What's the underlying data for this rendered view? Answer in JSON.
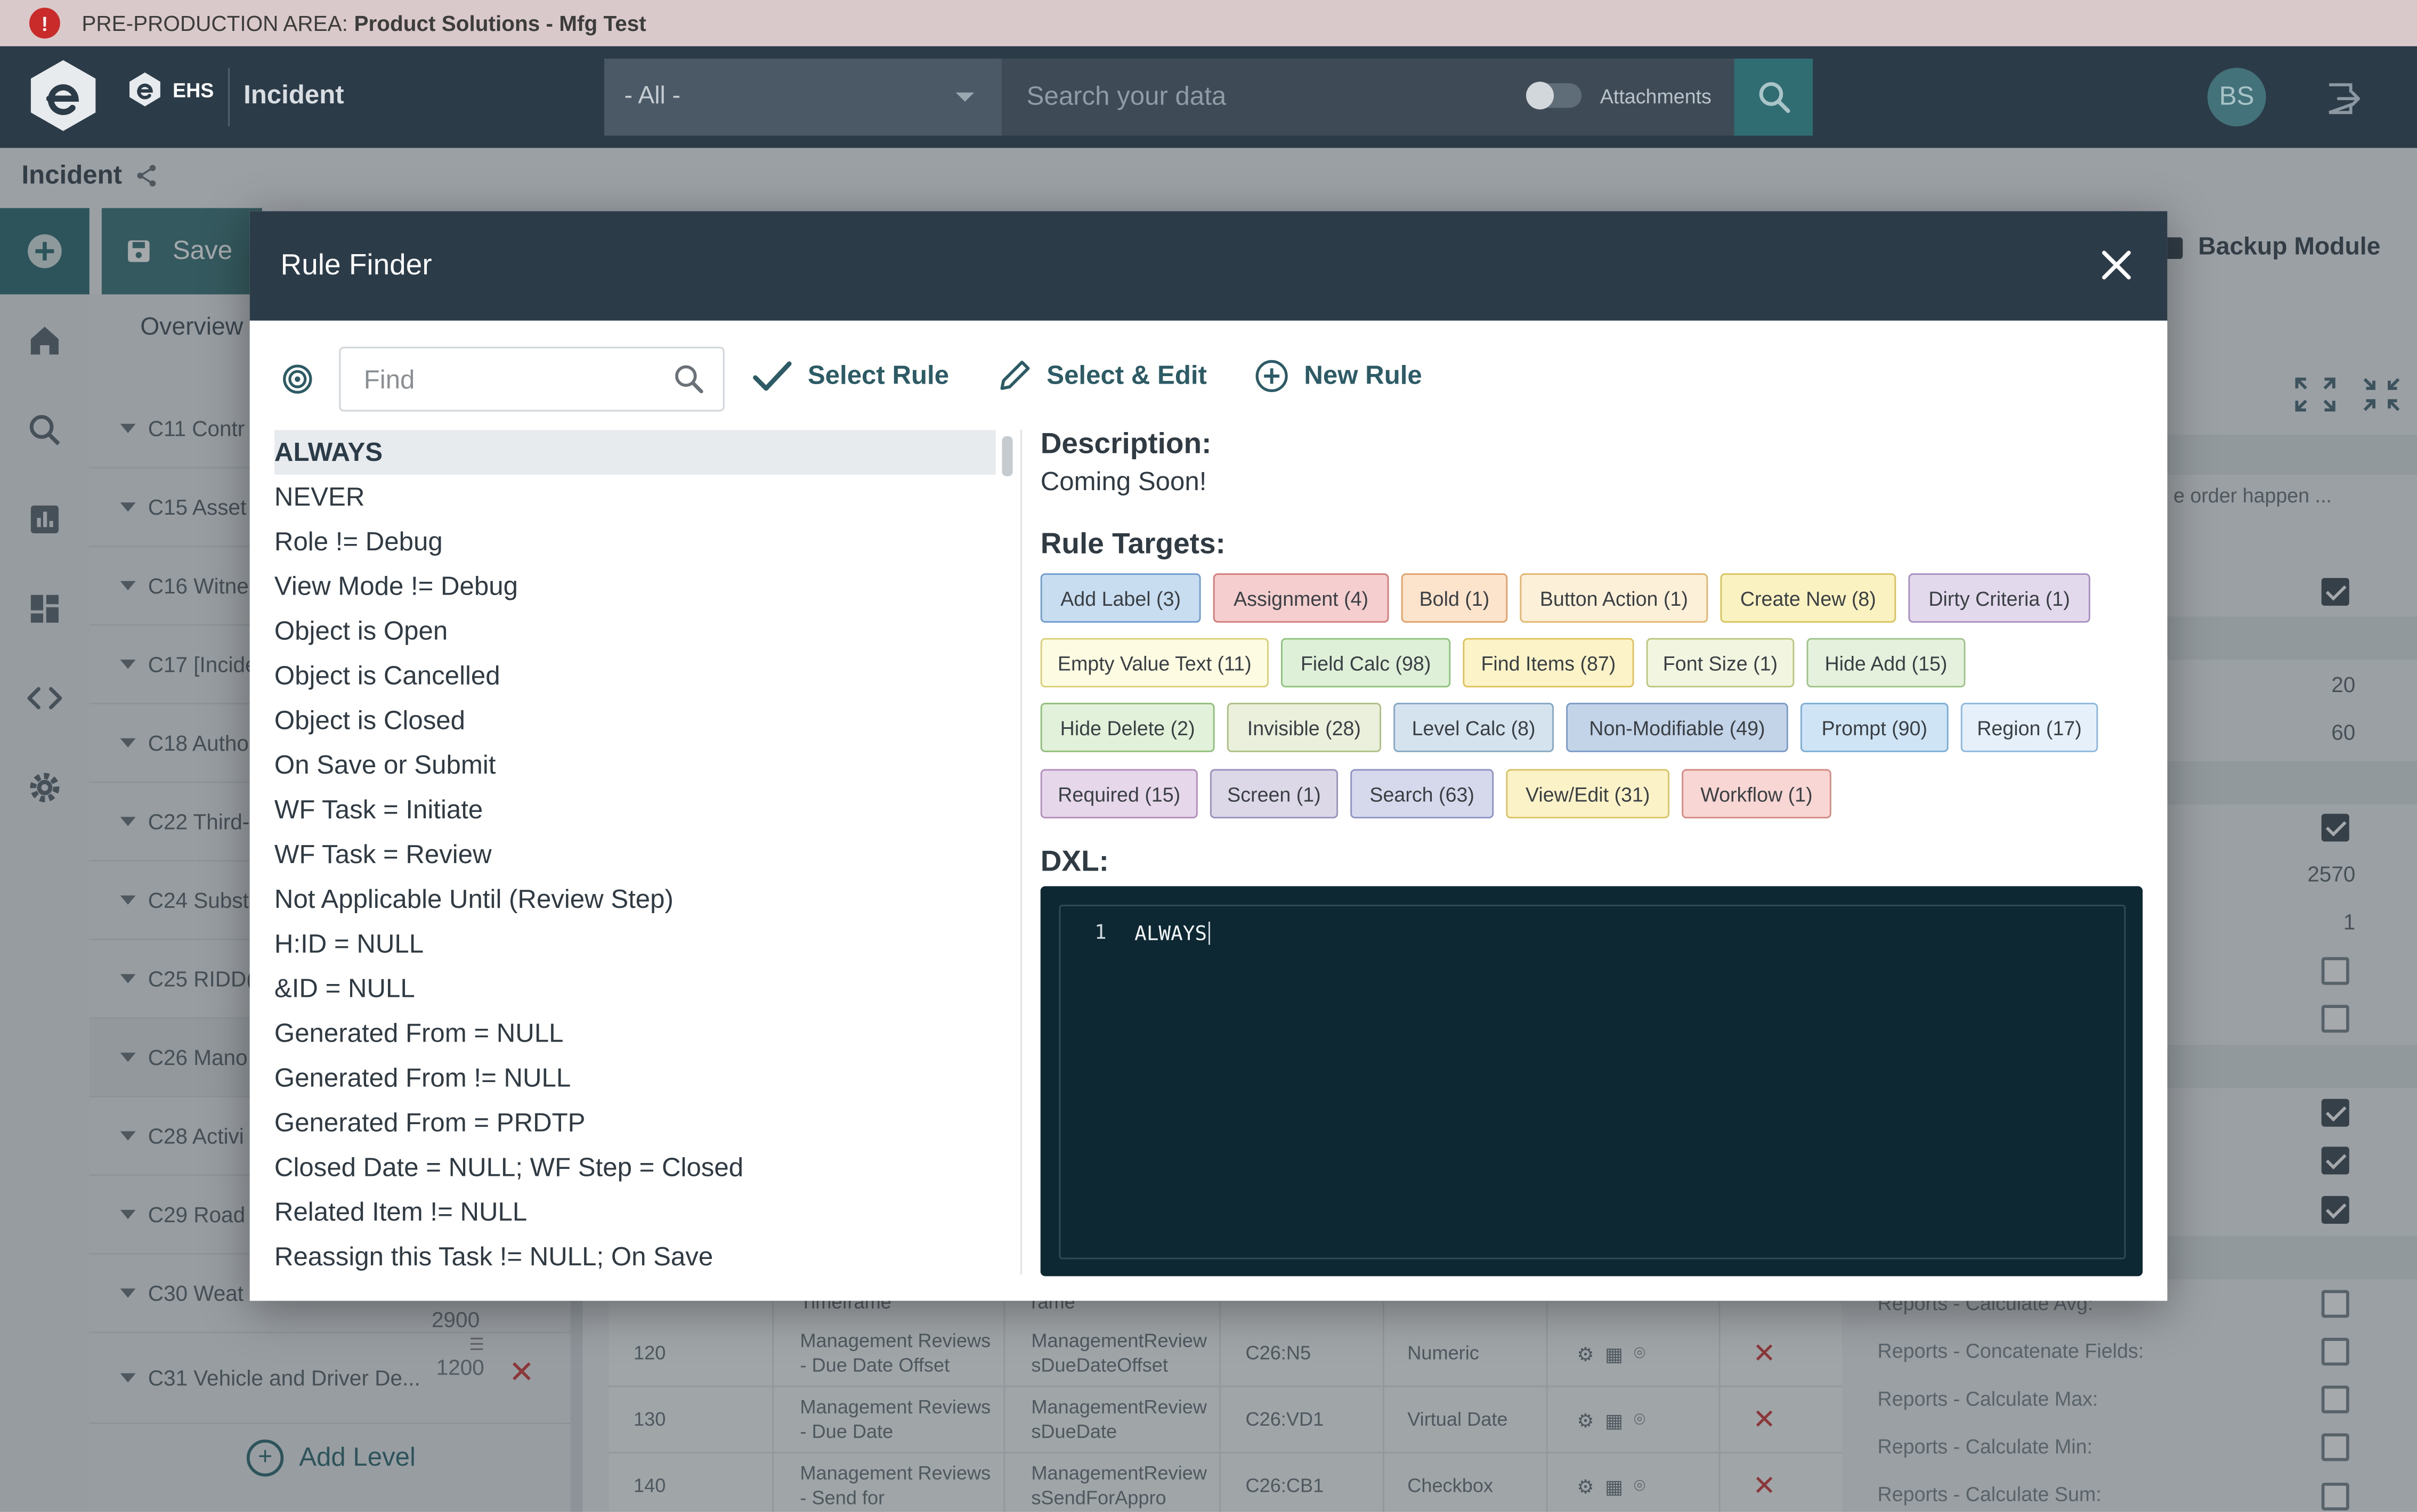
{
  "banner": {
    "prefix": "PRE-PRODUCTION AREA:",
    "name": "Product Solutions - Mfg Test",
    "icon": "alert-icon"
  },
  "header": {
    "ehs_label": "EHS",
    "module_title": "Incident",
    "scope_value": "- All -",
    "search_placeholder": "Search your data",
    "attachments_label": "Attachments",
    "user_initials": "BS"
  },
  "breadcrumb": {
    "title": "Incident"
  },
  "toolbar": {
    "save_label": "Save",
    "backup_label": "Backup Module"
  },
  "tree": {
    "tab": "Overview",
    "items": [
      {
        "label": "C11 Contr"
      },
      {
        "label": "C15 Asset"
      },
      {
        "label": "C16 Witne"
      },
      {
        "label": "C17 [Incide"
      },
      {
        "label": "C18 Autho"
      },
      {
        "label": "C22 Third-"
      },
      {
        "label": "C24 Subst"
      },
      {
        "label": "C25 RIDD("
      },
      {
        "label": "C26 Mano"
      },
      {
        "label": "C28 Activi"
      },
      {
        "label": "C29 Road"
      },
      {
        "label": "C30 Weat"
      },
      {
        "label": "C31 Vehicle and Driver De..."
      }
    ],
    "c30_count": "2900",
    "c31_count": "1200",
    "add_level": "Add Level"
  },
  "bg_table": {
    "top_fragment": {
      "name": "Timeframe",
      "field": "rame"
    },
    "rows": [
      {
        "seq": "120",
        "name": "Management Reviews - Due Date Offset",
        "field": "ManagementReviewsDueDateOffset",
        "ref": "C26:N5",
        "type": "Numeric"
      },
      {
        "seq": "130",
        "name": "Management Reviews - Due Date",
        "field": "ManagementReviewsDueDate",
        "ref": "C26:VD1",
        "type": "Virtual Date"
      },
      {
        "seq": "140",
        "name": "Management Reviews - Send for",
        "field": "ManagementReviewsSendForAppro",
        "ref": "C26:CB1",
        "type": "Checkbox"
      }
    ]
  },
  "right_panel": {
    "truncated_text": "e order happen ...",
    "num1": "20",
    "num2": "60",
    "num3": "2570",
    "num4": "1",
    "report_labels": [
      "Reports - Calculate Avg:",
      "Reports - Concatenate Fields:",
      "Reports - Calculate Max:",
      "Reports - Calculate Min:",
      "Reports - Calculate Sum:"
    ]
  },
  "modal": {
    "title": "Rule Finder",
    "find_placeholder": "Find",
    "select_rule": "Select Rule",
    "select_edit": "Select & Edit",
    "new_rule": "New Rule",
    "rules": [
      "ALWAYS",
      "NEVER",
      "Role != Debug",
      "View Mode != Debug",
      "Object is Open",
      "Object is Cancelled",
      "Object is Closed",
      "On Save or Submit",
      "WF Task = Initiate",
      "WF Task = Review",
      "Not Applicable Until (Review Step)",
      "H:ID = NULL",
      "&ID = NULL",
      "Generated From = NULL",
      "Generated From != NULL",
      "Generated From = PRDTP",
      "Closed Date = NULL; WF Step = Closed",
      "Related Item != NULL",
      "Reassign this Task != NULL; On Save"
    ],
    "description_heading": "Description:",
    "description": "Coming Soon!",
    "targets_heading": "Rule Targets:",
    "targets": [
      {
        "label": "Add Label (3)",
        "bg": "#c9ddf1",
        "border": "#6f9ccc"
      },
      {
        "label": "Assignment (4)",
        "bg": "#f5cfcf",
        "border": "#d47b7b"
      },
      {
        "label": "Bold (1)",
        "bg": "#fbe3cc",
        "border": "#e0a26a"
      },
      {
        "label": "Button Action (1)",
        "bg": "#fdf0d8",
        "border": "#e2b56f"
      },
      {
        "label": "Create New (8)",
        "bg": "#fbf2c2",
        "border": "#d8c45c"
      },
      {
        "label": "Dirty Criteria (1)",
        "bg": "#e3d9ec",
        "border": "#a88fc2"
      },
      {
        "label": "Empty Value Text (11)",
        "bg": "#fdfbe2",
        "border": "#d8cf77"
      },
      {
        "label": "Field Calc (98)",
        "bg": "#dff0d9",
        "border": "#8fc27d"
      },
      {
        "label": "Find Items (87)",
        "bg": "#fdf3c9",
        "border": "#dec25a"
      },
      {
        "label": "Font Size (1)",
        "bg": "#f2f6e1",
        "border": "#b9c77f"
      },
      {
        "label": "Hide Add (15)",
        "bg": "#e6f1dd",
        "border": "#9dc389"
      },
      {
        "label": "Hide Delete (2)",
        "bg": "#e2f1d9",
        "border": "#90bf7c"
      },
      {
        "label": "Invisible (28)",
        "bg": "#eaf0dc",
        "border": "#aebf85"
      },
      {
        "label": "Level Calc (8)",
        "bg": "#d5e3ee",
        "border": "#85a8c4"
      },
      {
        "label": "Non-Modifiable (49)",
        "bg": "#c4d4e8",
        "border": "#7b9bc6"
      },
      {
        "label": "Prompt (90)",
        "bg": "#cfe4f5",
        "border": "#7aaed6"
      },
      {
        "label": "Region (17)",
        "bg": "#e5f0fa",
        "border": "#8db8dd"
      },
      {
        "label": "Required (15)",
        "bg": "#e6d7ea",
        "border": "#b38fbe"
      },
      {
        "label": "Screen (1)",
        "bg": "#dcd8e8",
        "border": "#9a91bf"
      },
      {
        "label": "Search (63)",
        "bg": "#d6d8ec",
        "border": "#8f93c6"
      },
      {
        "label": "View/Edit (31)",
        "bg": "#fbf2c8",
        "border": "#d9c467"
      },
      {
        "label": "Workflow (1)",
        "bg": "#f7d6d3",
        "border": "#d68a84"
      }
    ],
    "dxl_heading": "DXL:",
    "dxl_line": "1",
    "dxl_code": "ALWAYS"
  },
  "colors": {
    "header": "#2c3b48",
    "accent": "#2f6d72",
    "danger": "#d23b3b"
  }
}
